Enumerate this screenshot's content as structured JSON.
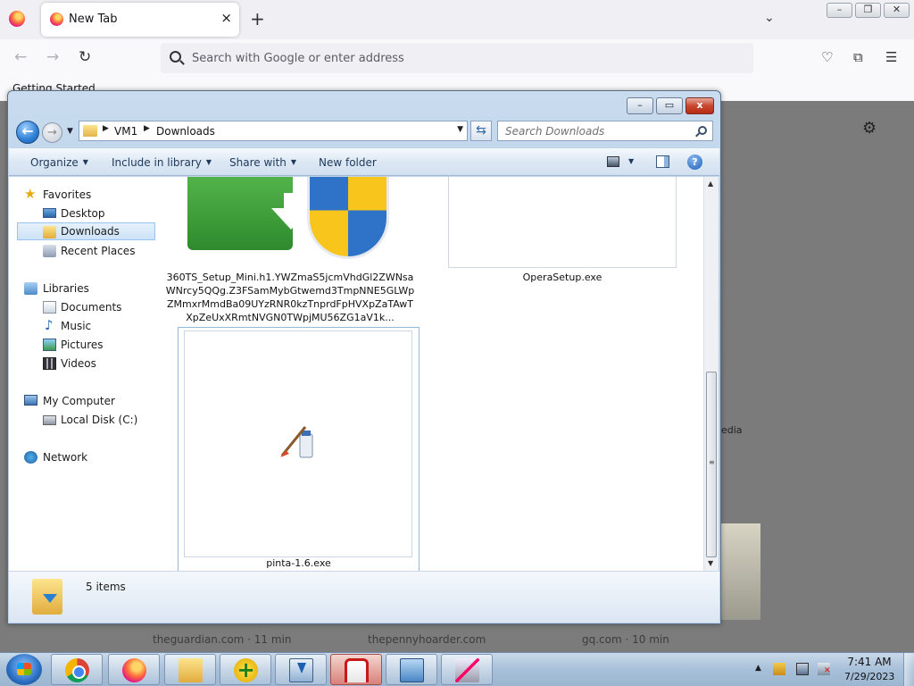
{
  "firefox": {
    "tab_title": "New Tab",
    "tab_close": "×",
    "new_tab": "+",
    "list_tabs": "⌄",
    "url_placeholder": "Search with Google or enter address",
    "bookmark": "Getting Started",
    "win_min": "–",
    "win_restore": "❐",
    "win_close": "✕",
    "back": "←",
    "forward": "→",
    "reload": "↻",
    "pocket": "♡",
    "extensions": "⧉",
    "menu": "☰",
    "settings_icon": "⚙",
    "media_label": "edia",
    "top_sites": [
      {
        "label": "theguardian.com · 11 min"
      },
      {
        "label": "thepennyhoarder.com"
      },
      {
        "label": "gq.com · 10 min"
      }
    ]
  },
  "explorer": {
    "caption": {
      "min": "–",
      "max": "▭",
      "close": "x"
    },
    "breadcrumb": [
      "VM1",
      "Downloads"
    ],
    "search_placeholder": "Search Downloads",
    "back_glyph": "←",
    "forward_glyph": "→",
    "refresh_glyph": "⇆",
    "toolbar": {
      "organize": "Organize",
      "include": "Include in library",
      "share": "Share with",
      "new_folder": "New folder",
      "help": "?"
    },
    "nav": {
      "favorites": "Favorites",
      "desktop": "Desktop",
      "downloads": "Downloads",
      "recent": "Recent Places",
      "libraries": "Libraries",
      "documents": "Documents",
      "music": "Music",
      "pictures": "Pictures",
      "videos": "Videos",
      "computer": "My Computer",
      "local_disk": "Local Disk (C:)",
      "network": "Network"
    },
    "files": [
      {
        "name": "360TS_Setup_Mini.h1.YWZmaS5jcmVhdGl2ZWNsaWNrcy5QQg.Z3FSamMybGtwemd3TmpNNE5GLWpZMmxrMmdBa09UYzRNR0kzTnprdFpHVXpZaTAwTXpZeUxXRmtNVGN0TWpjMU56ZG1aV1k..."
      },
      {
        "name": "OperaSetup.exe"
      },
      {
        "name": "pinta-1.6.exe"
      }
    ],
    "status": {
      "item_count": "5 items"
    }
  },
  "taskbar": {
    "clock_time": "7:41 AM",
    "clock_date": "7/29/2023"
  }
}
